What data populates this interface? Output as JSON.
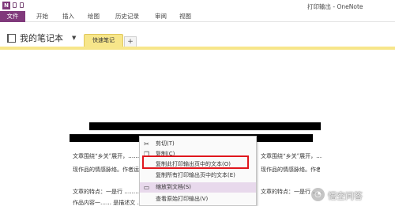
{
  "window": {
    "title": "打印输出 - OneNote"
  },
  "colors": {
    "accent": "#80397b",
    "section_tab": "#f7e68a",
    "highlight_box": "#e0161d"
  },
  "ribbon": {
    "file_label": "文件",
    "tabs": [
      "开始",
      "插入",
      "绘图",
      "历史记录",
      "审阅",
      "视图"
    ]
  },
  "notebook": {
    "name": "我的笔记本",
    "section": "快速笔记",
    "add_section": "+"
  },
  "document": {
    "lines": [
      "文章围绕“乡关”展开，……… 作者以二八个多个口了来先",
      "现作品的情感脉络。作者运用 ……… 处处有趣……… 享受发出内心的感动。",
      "文章的特点：一是行 ……… 运用方面：二是文字清秀隽永",
      "作品内容一…… 是描述文 ……… 从时间维度……… 家庭 ……… 等与 ……… 而出"
    ]
  },
  "context_menu": {
    "items": [
      {
        "icon": "cut-icon",
        "glyph": "✂",
        "label": "剪切(T)"
      },
      {
        "icon": "copy-icon",
        "glyph": "❐",
        "label": "复制(C)"
      },
      {
        "icon": "copy-text-icon",
        "glyph": "",
        "label": "复制此打印输出页中的文本(O)"
      },
      {
        "icon": "copy-all-text-icon",
        "glyph": "",
        "label": "复制所有打印输出页中的文本(E)"
      },
      {
        "icon": "fit-page-icon",
        "glyph": "▭",
        "label": "缩放到文档(S)"
      },
      {
        "icon": "view-original-icon",
        "glyph": "",
        "label": "查看原始打印输出(V)"
      }
    ]
  },
  "watermark": {
    "text": "悟空问答"
  }
}
